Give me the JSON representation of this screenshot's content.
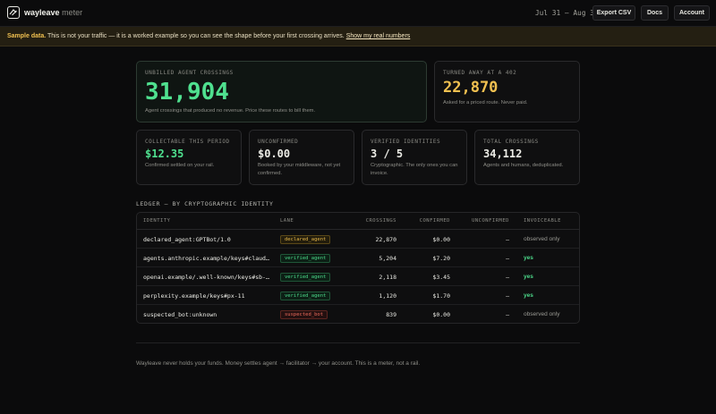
{
  "header": {
    "brand_name": "wayleave",
    "brand_suffix": "meter",
    "date_range": "Jul 31 — Aug 31",
    "buttons": {
      "export": "Export CSV",
      "docs": "Docs",
      "account": "Account"
    }
  },
  "banner": {
    "strong": "Sample data.",
    "text": " This is not your traffic — it is a worked example so you can see the shape before your first crossing arrives. ",
    "link": "Show my real numbers"
  },
  "hero": {
    "label": "UNBILLED AGENT CROSSINGS",
    "value": "31,904",
    "sub": "Agent crossings that produced no revenue. Price these routes to bill them.",
    "color": "#4fe08f"
  },
  "turned_away": {
    "label": "TURNED AWAY AT A 402",
    "value": "22,870",
    "sub": "Asked for a priced route. Never paid.",
    "color": "#f0c050"
  },
  "stats": [
    {
      "label": "COLLECTABLE THIS PERIOD",
      "value": "$12.35",
      "sub": "Confirmed settled on your rail.",
      "color": "#4fe08f"
    },
    {
      "label": "UNCONFIRMED",
      "value": "$0.00",
      "sub": "Booked by your middleware, not yet confirmed.",
      "color": "#ecece6"
    },
    {
      "label": "VERIFIED IDENTITIES",
      "value": "3 / 5",
      "sub": "Cryptographic. The only ones you can invoice.",
      "color": "#ecece6"
    },
    {
      "label": "TOTAL CROSSINGS",
      "value": "34,112",
      "sub": "Agents and humans, deduplicated.",
      "color": "#ecece6"
    }
  ],
  "ledger": {
    "title": "LEDGER — BY CRYPTOGRAPHIC IDENTITY",
    "columns": {
      "identity": "IDENTITY",
      "lane": "LANE",
      "crossings": "CROSSINGS",
      "confirmed": "CONFIRMED",
      "unconfirmed": "UNCONFIRMED",
      "invoiceable": "INVOICEABLE"
    },
    "rows": [
      {
        "identity": "declared_agent:GPTBot/1.0",
        "lane": "declared_agent",
        "crossings": "22,870",
        "confirmed": "$0.00",
        "unconfirmed": "—",
        "invoiceable": "observed only"
      },
      {
        "identity": "agents.anthropic.example/keys#claude…",
        "lane": "verified_agent",
        "crossings": "5,204",
        "confirmed": "$7.20",
        "unconfirmed": "—",
        "invoiceable": "yes"
      },
      {
        "identity": "openai.example/.well-known/keys#sb-2…",
        "lane": "verified_agent",
        "crossings": "2,118",
        "confirmed": "$3.45",
        "unconfirmed": "—",
        "invoiceable": "yes"
      },
      {
        "identity": "perplexity.example/keys#px-11",
        "lane": "verified_agent",
        "crossings": "1,120",
        "confirmed": "$1.70",
        "unconfirmed": "—",
        "invoiceable": "yes"
      },
      {
        "identity": "suspected_bot:unknown",
        "lane": "suspected_bot",
        "crossings": "839",
        "confirmed": "$0.00",
        "unconfirmed": "—",
        "invoiceable": "observed only"
      }
    ]
  },
  "footer": "Wayleave never holds your funds. Money settles agent → facilitator → your account. This is a meter, not a rail."
}
